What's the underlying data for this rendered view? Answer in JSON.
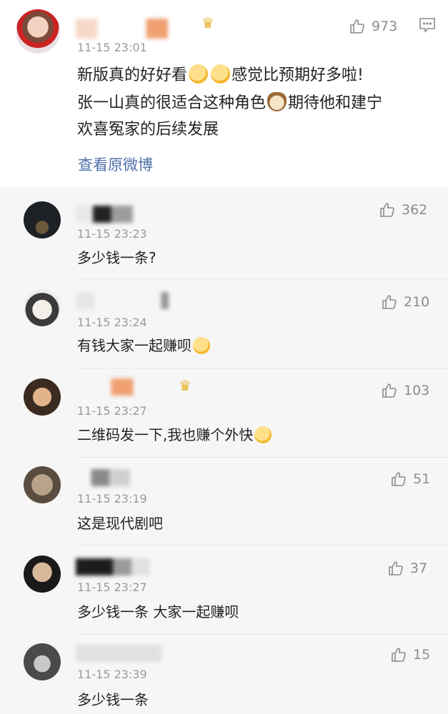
{
  "main_comment": {
    "time": "11-15 23:01",
    "likes": "973",
    "text_line1_a": "新版真的好好看",
    "text_line1_b": "感觉比预期好多啦!",
    "text_line2_a": "张一山真的很适合这种角色",
    "text_line2_b": "期待他和建宁",
    "text_line3": "欢喜冤家的后续发展",
    "view_original": "查看原微博"
  },
  "replies": [
    {
      "time": "11-15 23:23",
      "likes": "362",
      "text": "多少钱一条?"
    },
    {
      "time": "11-15 23:24",
      "likes": "210",
      "text": "有钱大家一起赚呗"
    },
    {
      "time": "11-15 23:27",
      "likes": "103",
      "text": "二维码发一下,我也赚个外快"
    },
    {
      "time": "11-15 23:19",
      "likes": "51",
      "text": "这是现代剧吧"
    },
    {
      "time": "11-15 23:27",
      "likes": "37",
      "text": "多少钱一条 大家一起赚呗"
    },
    {
      "time": "11-15 23:39",
      "likes": "15",
      "text": "多少钱一条"
    }
  ],
  "colors": {
    "link": "#4f6fa8",
    "muted": "#9a9a9a",
    "reply_bg": "#f6f6f6"
  },
  "icons": [
    "thumbs-up-icon",
    "comment-icon",
    "crown-badge-icon",
    "emoji-icon"
  ]
}
